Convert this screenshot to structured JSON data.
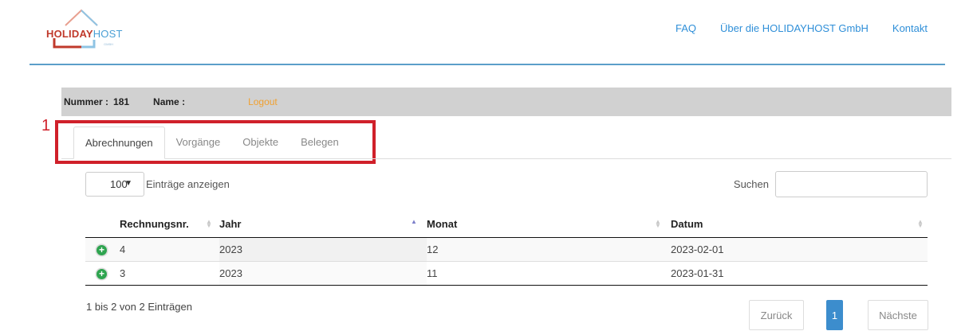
{
  "logo": {
    "text_part1": "HOLIDAY",
    "text_part2": "HOST",
    "subtext": "GMBH"
  },
  "nav": {
    "faq": "FAQ",
    "about": "Über die HOLIDAYHOST GmbH",
    "contact": "Kontakt"
  },
  "user": {
    "nummer_label": "Nummer :",
    "nummer_value": "181",
    "name_label": "Name :",
    "logout": "Logout"
  },
  "annotation": {
    "marker": "1"
  },
  "tabs": [
    {
      "label": "Abrechnungen",
      "active": true
    },
    {
      "label": "Vorgänge",
      "active": false
    },
    {
      "label": "Objekte",
      "active": false
    },
    {
      "label": "Belegen",
      "active": false
    }
  ],
  "controls": {
    "page_size": "100",
    "entries_label": "Einträge anzeigen",
    "search_label": "Suchen",
    "search_value": ""
  },
  "table": {
    "columns": [
      "Rechnungsnr.",
      "Jahr",
      "Monat",
      "Datum"
    ],
    "rows": [
      {
        "rechnungsnr": "4",
        "jahr": "2023",
        "monat": "12",
        "datum": "2023-02-01"
      },
      {
        "rechnungsnr": "3",
        "jahr": "2023",
        "monat": "11",
        "datum": "2023-01-31"
      }
    ]
  },
  "footer": {
    "info": "1 bis 2 von 2 Einträgen",
    "prev": "Zurück",
    "current_page": "1",
    "next": "Nächste"
  },
  "colors": {
    "accent": "#3c8dcd",
    "link": "#2f8fd8",
    "logout": "#f0a030",
    "annotation": "#d0202a",
    "expand_icon": "#2ea44f"
  }
}
